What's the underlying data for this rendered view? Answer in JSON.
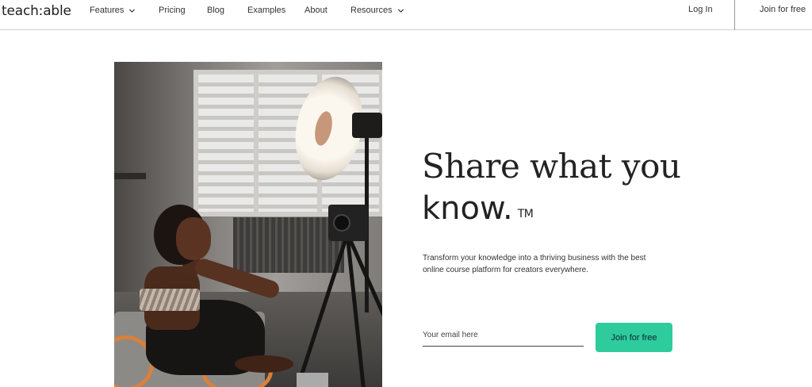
{
  "brand": {
    "logo_text": "teach:able"
  },
  "nav": {
    "items": [
      {
        "label": "Features",
        "has_dropdown": true
      },
      {
        "label": "Pricing",
        "has_dropdown": false
      },
      {
        "label": "Blog",
        "has_dropdown": false
      },
      {
        "label": "Examples",
        "has_dropdown": false
      },
      {
        "label": "About",
        "has_dropdown": false
      },
      {
        "label": "Resources",
        "has_dropdown": true
      }
    ],
    "login_label": "Log In",
    "join_label": "Join for free"
  },
  "hero": {
    "title_line1": "Share what you",
    "title_line2": "know.",
    "trademark": "TM",
    "subtitle": "Transform your knowledge into a thriving business with the best online course platform for creators everywhere.",
    "email_placeholder": "Your email here",
    "cta_label": "Join for free"
  },
  "colors": {
    "accent": "#2ecc9d",
    "text": "#222222",
    "nav_border": "#cfcfcf"
  },
  "icons": {
    "dropdown": "chevron-down-icon"
  }
}
